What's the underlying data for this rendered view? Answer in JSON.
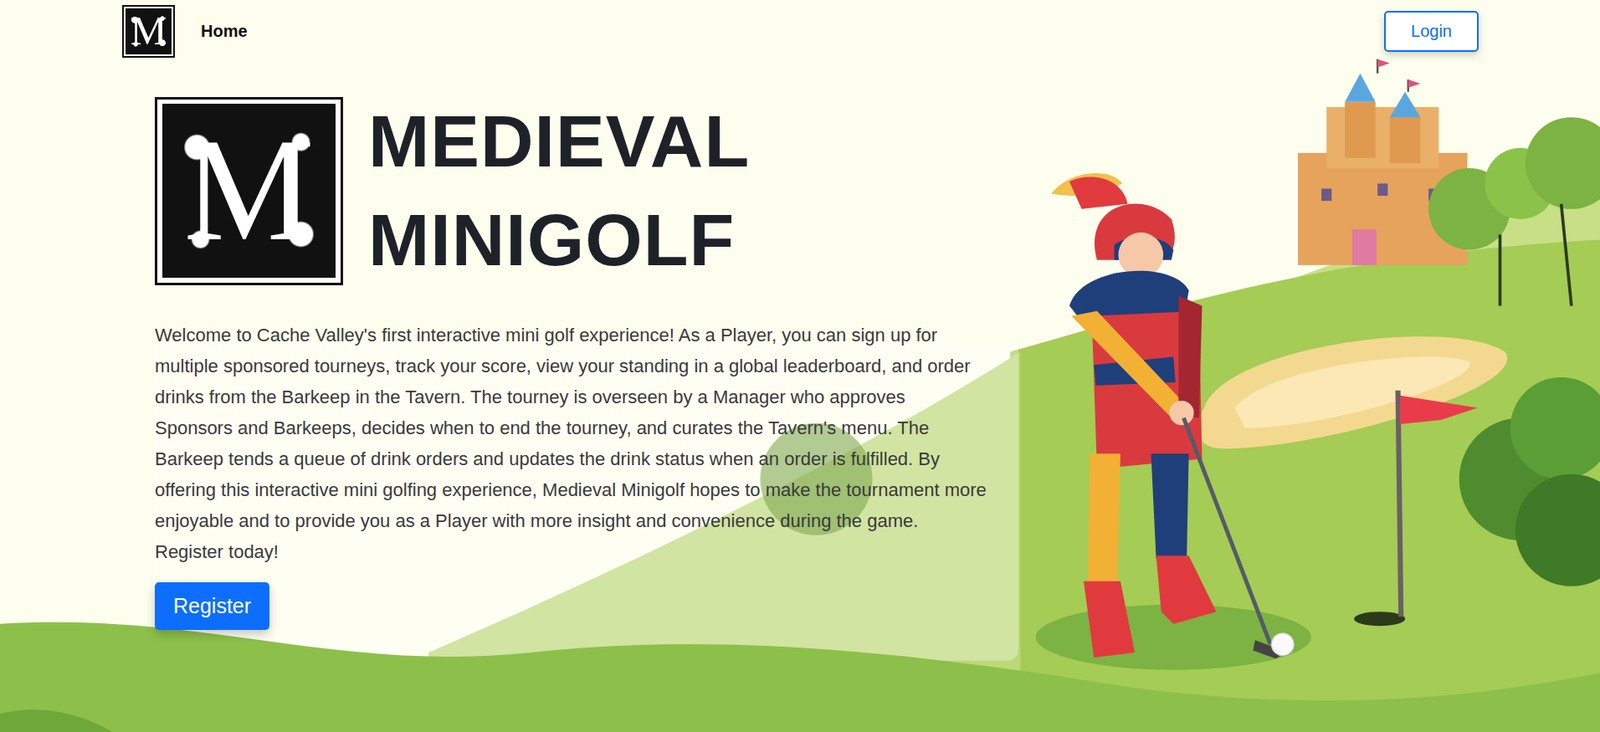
{
  "nav": {
    "logo_letter": "M",
    "links": [
      {
        "label": "Home",
        "selected": true
      }
    ],
    "login": "Login"
  },
  "hero": {
    "logo_letter": "M",
    "title_lines": [
      "MEDIEVAL",
      "MINIGOLF"
    ],
    "description": "Welcome to Cache Valley's first interactive mini golf experience! As a Player, you can sign up for multiple sponsored tourneys, track your score, view your standing in a global leaderboard, and order drinks from the Barkeep in the Tavern. The tourney is overseen by a Manager who approves Sponsors and Barkeeps, decides when to end the tourney, and curates the Tavern's menu. The Barkeep tends a queue of drink orders and updates the drink status when an order is fulfilled. By offering this interactive mini golfing experience, Medieval Minigolf hopes to make the tournament more enjoyable and to provide you as a Player with more insight and convenience during the game. Register today!",
    "register": "Register"
  }
}
